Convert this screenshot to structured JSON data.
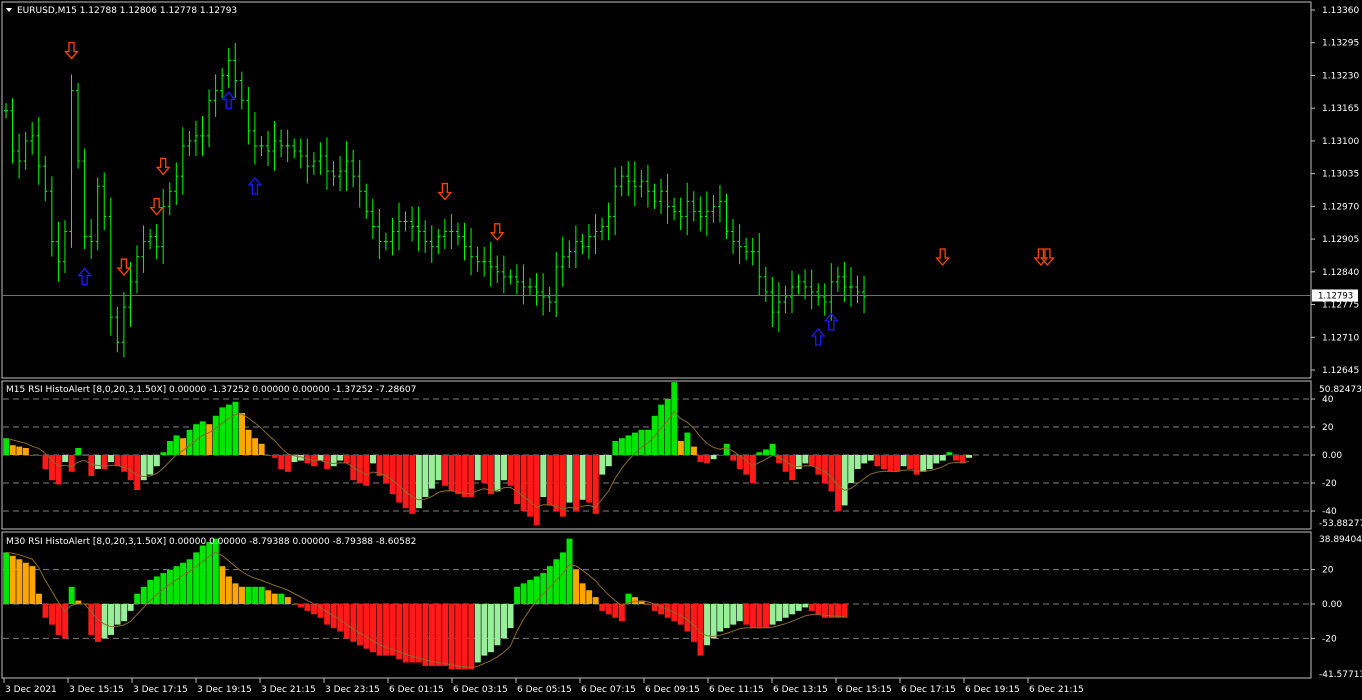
{
  "price_panel": {
    "title": "EURUSD,M15  1.12788 1.12806 1.12778 1.12793",
    "current_price": "1.12793",
    "current_value": 1.12793,
    "y_ticks": [
      "1.13360",
      "1.13295",
      "1.13230",
      "1.13165",
      "1.13100",
      "1.13035",
      "1.12970",
      "1.12905",
      "1.12840",
      "1.12775",
      "1.12710",
      "1.12645"
    ],
    "y_range": [
      1.12645,
      1.1336
    ],
    "bar_color": "#00ff00",
    "buy_arrow_color": "#1a1aff",
    "sell_arrow_color": "#ff4500"
  },
  "m15_panel": {
    "title": "M15 RSI HistoAlert [8,0,20,3,1.50X] 0.00000 -1.37252 0.00000 0.00000 -1.37252 -7.28607",
    "max_label": "50.82473",
    "min_label": "-53.88277",
    "y_ticks": [
      "40",
      "20",
      "0.00",
      "-20",
      "-40"
    ],
    "zero_label": "0.00"
  },
  "m30_panel": {
    "title": "M30 RSI HistoAlert [8,0,20,3,1.50X] 0.00000 0.00000 -8.79388 0.00000 -8.79388 -8.60582",
    "max_label": "38.89404",
    "min_label": "-41.57713",
    "y_ticks": [
      "20",
      "0.00",
      "-20"
    ],
    "zero_label": "0.00"
  },
  "time_axis": [
    "3 Dec 2021",
    "3 Dec 15:15",
    "3 Dec 17:15",
    "3 Dec 19:15",
    "3 Dec 21:15",
    "3 Dec 23:15",
    "6 Dec 01:15",
    "6 Dec 03:15",
    "6 Dec 05:15",
    "6 Dec 07:15",
    "6 Dec 09:15",
    "6 Dec 11:15",
    "6 Dec 13:15",
    "6 Dec 15:15",
    "6 Dec 17:15",
    "6 Dec 19:15",
    "6 Dec 21:15"
  ],
  "colors": {
    "strong_up": "#00e600",
    "weak_up": "#ffa500",
    "strong_down": "#ff1a1a",
    "weak_down": "#99ee99",
    "grid": "#808080",
    "axis_text": "#ffffff"
  },
  "chart_data": {
    "type": "ohlc",
    "close_prices": [
      1.1316,
      1.1308,
      1.1306,
      1.131,
      1.1311,
      1.1305,
      1.13,
      1.129,
      1.1286,
      1.1292,
      1.132,
      1.1306,
      1.1291,
      1.129,
      1.1301,
      1.1295,
      1.1275,
      1.127,
      1.1277,
      1.1282,
      1.1287,
      1.129,
      1.1291,
      1.1289,
      1.1297,
      1.13,
      1.1303,
      1.1309,
      1.131,
      1.1311,
      1.1311,
      1.1318,
      1.132,
      1.1323,
      1.1326,
      1.1322,
      1.1318,
      1.1312,
      1.1309,
      1.1309,
      1.1308,
      1.131,
      1.1309,
      1.1309,
      1.1308,
      1.1307,
      1.1305,
      1.1306,
      1.1307,
      1.1304,
      1.1303,
      1.1304,
      1.1306,
      1.1303,
      1.13,
      1.1296,
      1.1293,
      1.129,
      1.129,
      1.1292,
      1.1294,
      1.1294,
      1.1293,
      1.1292,
      1.129,
      1.1289,
      1.1291,
      1.1292,
      1.1292,
      1.1291,
      1.1289,
      1.1287,
      1.1286,
      1.1286,
      1.1285,
      1.1284,
      1.1283,
      1.1283,
      1.1282,
      1.1281,
      1.1281,
      1.128,
      1.1279,
      1.1278,
      1.1285,
      1.1287,
      1.1288,
      1.129,
      1.1289,
      1.1291,
      1.1292,
      1.1293,
      1.1295,
      1.1301,
      1.1303,
      1.1302,
      1.1301,
      1.1302,
      1.13,
      1.1298,
      1.13,
      1.1297,
      1.1296,
      1.1295,
      1.1298,
      1.1296,
      1.1295,
      1.1296,
      1.1297,
      1.1298,
      1.1292,
      1.129,
      1.1289,
      1.1288,
      1.1288,
      1.1283,
      1.128,
      1.1276,
      1.1278,
      1.1279,
      1.1281,
      1.1282,
      1.1281,
      1.128,
      1.1279,
      1.1278,
      1.1282,
      1.1283,
      1.1281,
      1.1281,
      1.128,
      1.1279
    ],
    "m15_histogram": [
      12,
      7,
      6,
      5,
      0,
      0,
      -10,
      -18,
      -21,
      -5,
      -12,
      5,
      0,
      -15,
      -10,
      -10,
      -5,
      -8,
      -12,
      -18,
      -25,
      -18,
      -14,
      -8,
      2,
      10,
      14,
      12,
      18,
      22,
      24,
      22,
      28,
      34,
      36,
      38,
      30,
      18,
      12,
      8,
      0,
      -2,
      -10,
      -12,
      -5,
      -4,
      -6,
      -8,
      -4,
      -10,
      -8,
      -4,
      -6,
      -18,
      -20,
      -22,
      -6,
      -15,
      -20,
      -28,
      -34,
      -38,
      -42,
      -38,
      -30,
      -24,
      -18,
      -22,
      -26,
      -28,
      -30,
      -30,
      -18,
      -20,
      -28,
      -26,
      -18,
      -22,
      -35,
      -40,
      -44,
      -50,
      -30,
      -36,
      -40,
      -44,
      -34,
      -40,
      -32,
      -34,
      -42,
      -14,
      -8,
      10,
      12,
      14,
      16,
      18,
      18,
      28,
      36,
      40,
      52,
      10,
      16,
      6,
      -5,
      -6,
      -3,
      0,
      8,
      -4,
      -10,
      -14,
      -20,
      2,
      4,
      8,
      -6,
      -12,
      -18,
      -10,
      -6,
      -8,
      -14,
      -20,
      -26,
      -40,
      -36,
      -20,
      -10,
      -6,
      -4,
      -8,
      -10,
      -12,
      -12,
      -8,
      -10,
      -14,
      -12,
      -10,
      -6,
      -4,
      2,
      -4,
      -6,
      -2
    ],
    "m30_histogram": [
      30,
      28,
      26,
      24,
      22,
      6,
      -8,
      -12,
      -18,
      -20,
      10,
      2,
      0,
      -18,
      -22,
      -20,
      -18,
      -12,
      -10,
      -4,
      6,
      10,
      14,
      16,
      18,
      20,
      22,
      24,
      26,
      30,
      34,
      36,
      38,
      22,
      16,
      12,
      10,
      10,
      10,
      10,
      8,
      6,
      6,
      4,
      0,
      -2,
      -4,
      -6,
      -8,
      -12,
      -14,
      -16,
      -20,
      -22,
      -24,
      -26,
      -28,
      -30,
      -30,
      -30,
      -32,
      -34,
      -34,
      -34,
      -36,
      -36,
      -36,
      -36,
      -38,
      -38,
      -38,
      -38,
      -34,
      -30,
      -28,
      -24,
      -20,
      -14,
      10,
      12,
      14,
      16,
      18,
      22,
      26,
      30,
      38,
      20,
      12,
      8,
      4,
      -4,
      -6,
      -8,
      -10,
      6,
      4,
      2,
      0,
      -4,
      -6,
      -8,
      -10,
      -12,
      -16,
      -22,
      -30,
      -24,
      -20,
      -16,
      -14,
      -12,
      -10,
      -12,
      -14,
      -14,
      -14,
      -12,
      -10,
      -8,
      -6,
      -4,
      -2,
      -4,
      -6,
      -8,
      -8,
      -8,
      -8
    ]
  },
  "signals": {
    "buy_arrows": [
      12,
      34,
      38,
      124,
      126
    ],
    "sell_arrows": [
      10,
      18,
      23,
      24,
      67,
      75,
      143,
      158,
      159
    ]
  }
}
